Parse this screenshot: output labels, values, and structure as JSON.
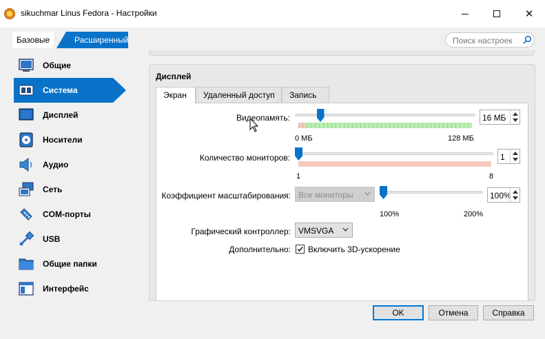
{
  "window": {
    "title": "sikuchmar Linus Fedora - Настройки",
    "controls": {
      "minimize": "minimize-icon",
      "maximize": "maximize-icon",
      "close": "✕"
    }
  },
  "mode_tabs": {
    "basic": "Базовые",
    "advanced": "Расширенный"
  },
  "search": {
    "placeholder": "Поиск настроек",
    "icon": "search-icon"
  },
  "sidebar": {
    "items": [
      {
        "label": "Общие",
        "icon": "general-icon",
        "active": false
      },
      {
        "label": "Система",
        "icon": "system-chip-icon",
        "active": true
      },
      {
        "label": "Дисплей",
        "icon": "display-icon",
        "active": false
      },
      {
        "label": "Носители",
        "icon": "storage-disk-icon",
        "active": false
      },
      {
        "label": "Аудио",
        "icon": "audio-speaker-icon",
        "active": false
      },
      {
        "label": "Сеть",
        "icon": "network-icon",
        "active": false
      },
      {
        "label": "COM-порты",
        "icon": "serial-port-icon",
        "active": false
      },
      {
        "label": "USB",
        "icon": "usb-icon",
        "active": false
      },
      {
        "label": "Общие папки",
        "icon": "shared-folder-icon",
        "active": false
      },
      {
        "label": "Интерфейс",
        "icon": "user-interface-icon",
        "active": false
      }
    ]
  },
  "display": {
    "section_title": "Дисплей",
    "tabs": [
      "Экран",
      "Удаленный доступ",
      "Запись"
    ],
    "active_tab": "Экран",
    "video_memory": {
      "label": "Видеопамять:",
      "value": "16 МБ",
      "value_mb": 16,
      "min_label": "0 МБ",
      "max_label": "128 МБ",
      "max_mb": 128
    },
    "monitor_count": {
      "label": "Количество мониторов:",
      "value": "1",
      "min_label": "1",
      "max_label": "8"
    },
    "scale_factor": {
      "label": "Коэффициент масштабирования:",
      "monitor_select": "Все мониторы",
      "value": "100%",
      "min_label": "100%",
      "max_label": "200%"
    },
    "graphics_controller": {
      "label": "Графический контроллер:",
      "value": "VMSVGA"
    },
    "extended": {
      "label": "Дополнительно:",
      "checkbox_label": "Включить 3D-ускорение",
      "checked": true
    }
  },
  "buttons": {
    "ok": "OK",
    "cancel": "Отмена",
    "help": "Справка"
  },
  "colors": {
    "accent": "#0a73c9",
    "band_red": "#f5cabc",
    "band_green": "#b9efb0"
  }
}
